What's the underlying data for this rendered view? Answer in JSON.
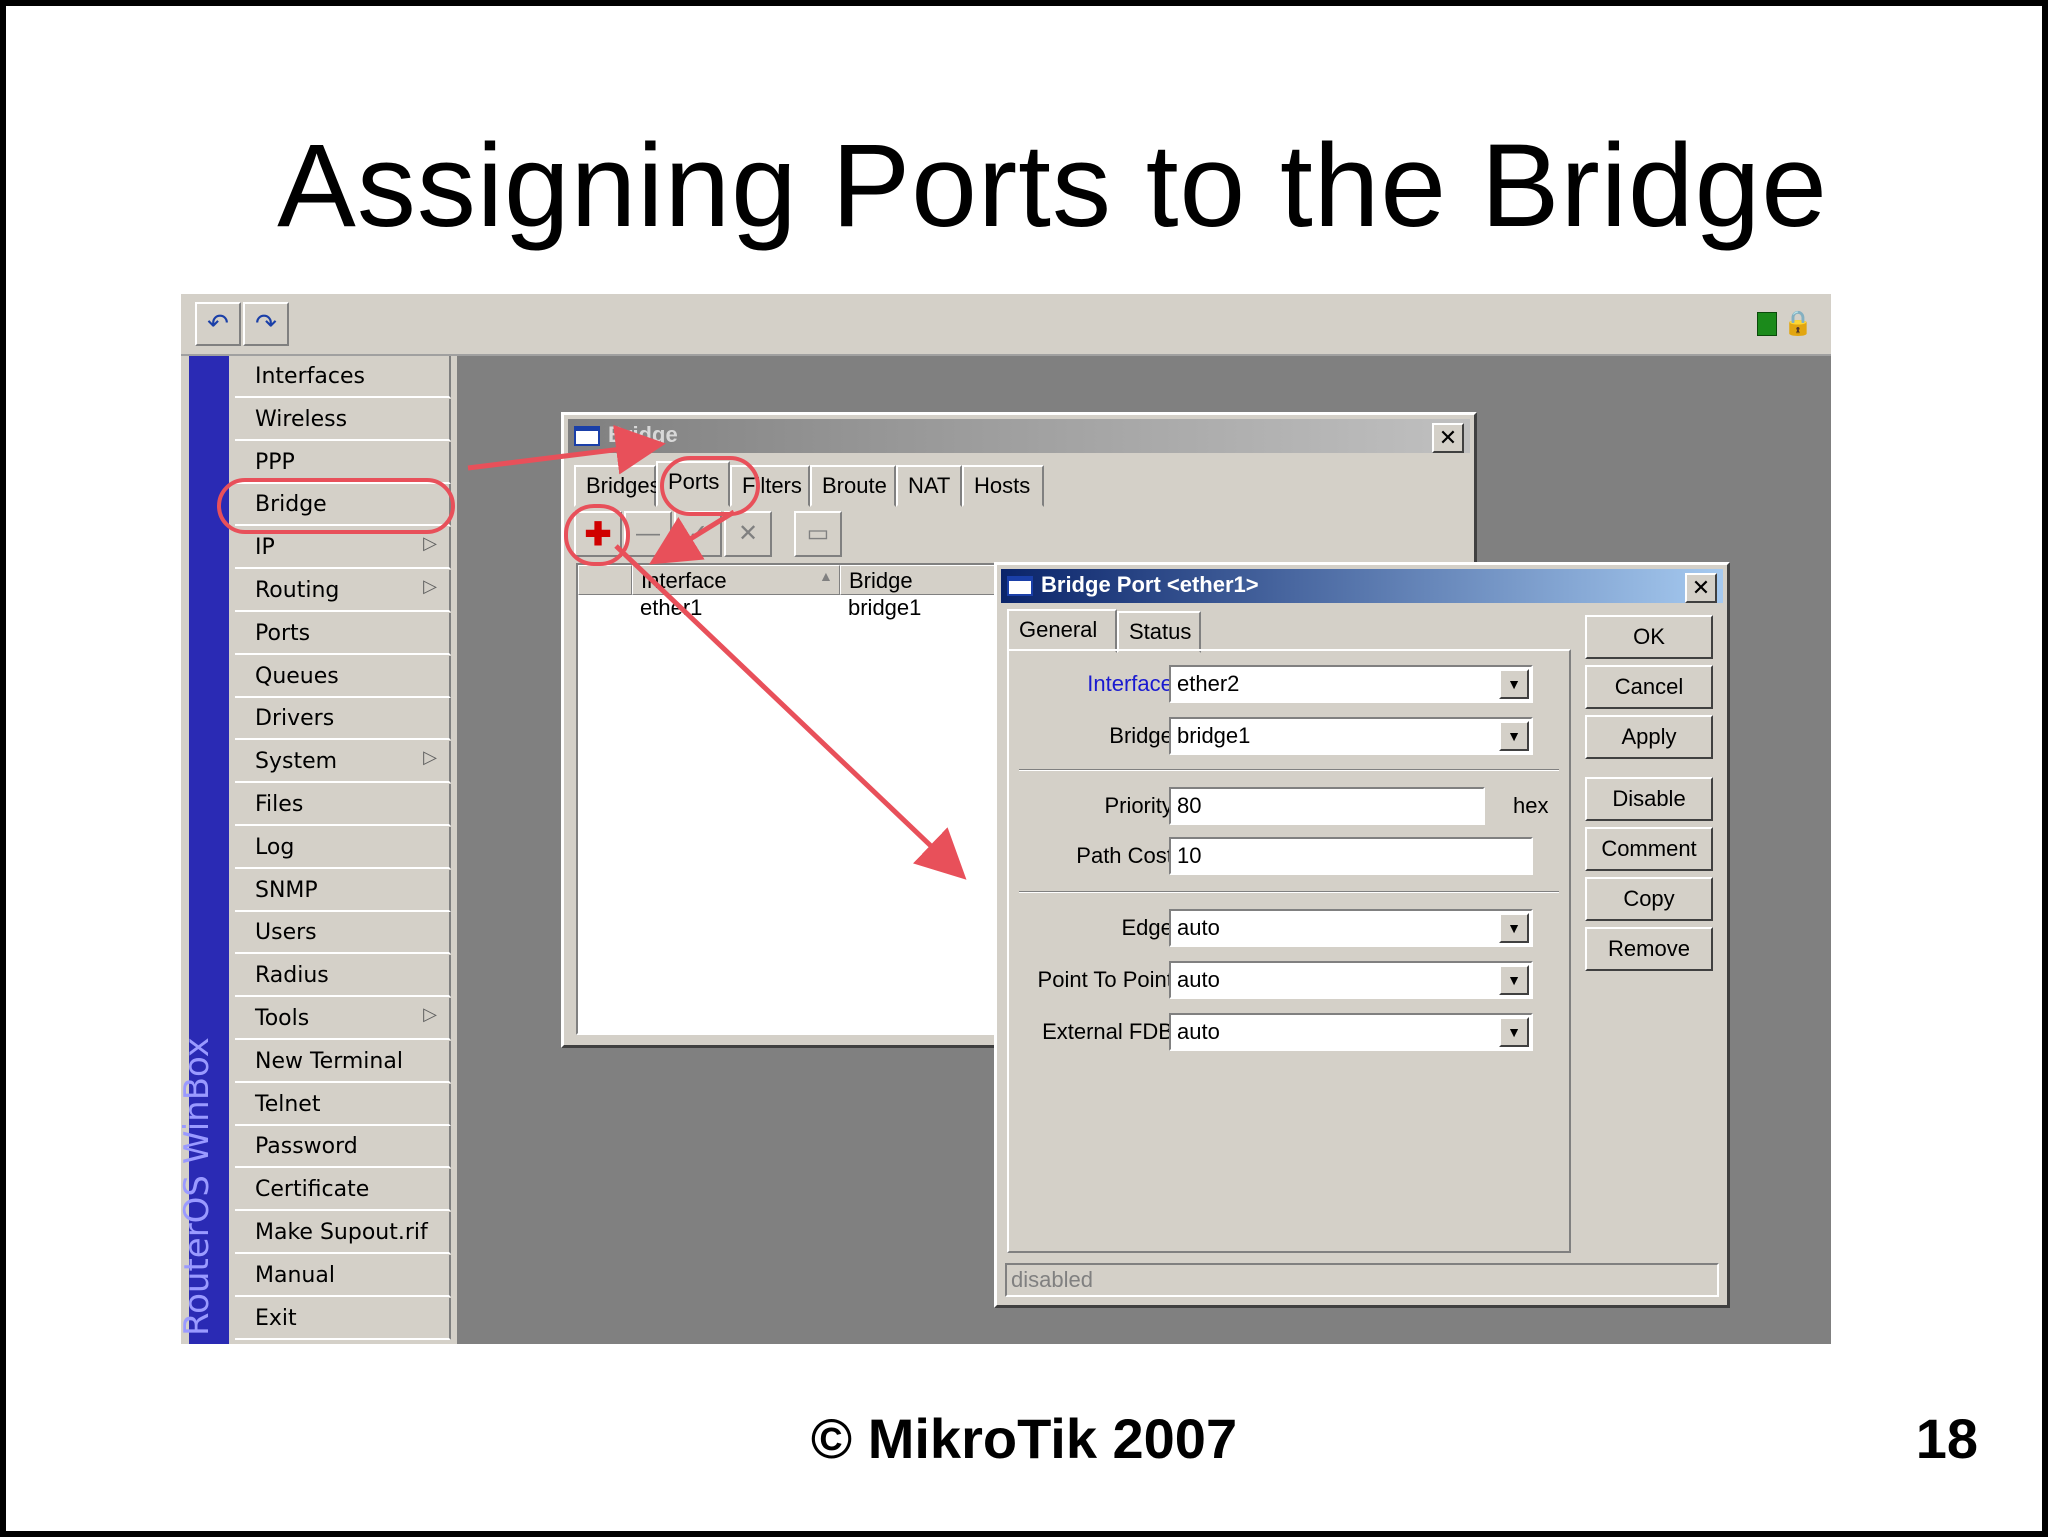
{
  "slide": {
    "title": "Assigning Ports to the Bridge",
    "footer": "© MikroTik 2007",
    "page_number": "18"
  },
  "winbox": {
    "brand": "RouterOS WinBox",
    "toolbar": {
      "undo_icon": "undo-icon",
      "redo_icon": "redo-icon"
    },
    "menu": [
      {
        "label": "Interfaces",
        "submenu": false
      },
      {
        "label": "Wireless",
        "submenu": false
      },
      {
        "label": "PPP",
        "submenu": false
      },
      {
        "label": "Bridge",
        "submenu": false
      },
      {
        "label": "IP",
        "submenu": true
      },
      {
        "label": "Routing",
        "submenu": true
      },
      {
        "label": "Ports",
        "submenu": false
      },
      {
        "label": "Queues",
        "submenu": false
      },
      {
        "label": "Drivers",
        "submenu": false
      },
      {
        "label": "System",
        "submenu": true
      },
      {
        "label": "Files",
        "submenu": false
      },
      {
        "label": "Log",
        "submenu": false
      },
      {
        "label": "SNMP",
        "submenu": false
      },
      {
        "label": "Users",
        "submenu": false
      },
      {
        "label": "Radius",
        "submenu": false
      },
      {
        "label": "Tools",
        "submenu": true
      },
      {
        "label": "New Terminal",
        "submenu": false
      },
      {
        "label": "Telnet",
        "submenu": false
      },
      {
        "label": "Password",
        "submenu": false
      },
      {
        "label": "Certificate",
        "submenu": false
      },
      {
        "label": "Make Supout.rif",
        "submenu": false
      },
      {
        "label": "Manual",
        "submenu": false
      },
      {
        "label": "Exit",
        "submenu": false
      }
    ]
  },
  "bridge_window": {
    "title": "Bridge",
    "tabs": [
      "Bridges",
      "Ports",
      "Filters",
      "Broute",
      "NAT",
      "Hosts"
    ],
    "active_tab": "Ports",
    "columns": [
      "Interface",
      "Bridge"
    ],
    "rows": [
      {
        "interface": "ether1",
        "bridge": "bridge1"
      }
    ]
  },
  "port_dialog": {
    "title": "Bridge Port <ether1>",
    "tabs": [
      "General",
      "Status"
    ],
    "fields": {
      "interface": {
        "label": "Interface:",
        "value": "ether2"
      },
      "bridge": {
        "label": "Bridge:",
        "value": "bridge1"
      },
      "priority": {
        "label": "Priority:",
        "value": "80",
        "unit": "hex"
      },
      "path_cost": {
        "label": "Path Cost:",
        "value": "10"
      },
      "edge": {
        "label": "Edge:",
        "value": "auto"
      },
      "point_to_point": {
        "label": "Point To Point:",
        "value": "auto"
      },
      "external_fdb": {
        "label": "External FDB:",
        "value": "auto"
      }
    },
    "buttons": [
      "OK",
      "Cancel",
      "Apply",
      "Disable",
      "Comment",
      "Copy",
      "Remove"
    ],
    "status": "disabled"
  },
  "colors": {
    "annotation": "#e8505a",
    "titlebar_active": "#0a246a",
    "brand_strip": "#2a2ab4"
  }
}
